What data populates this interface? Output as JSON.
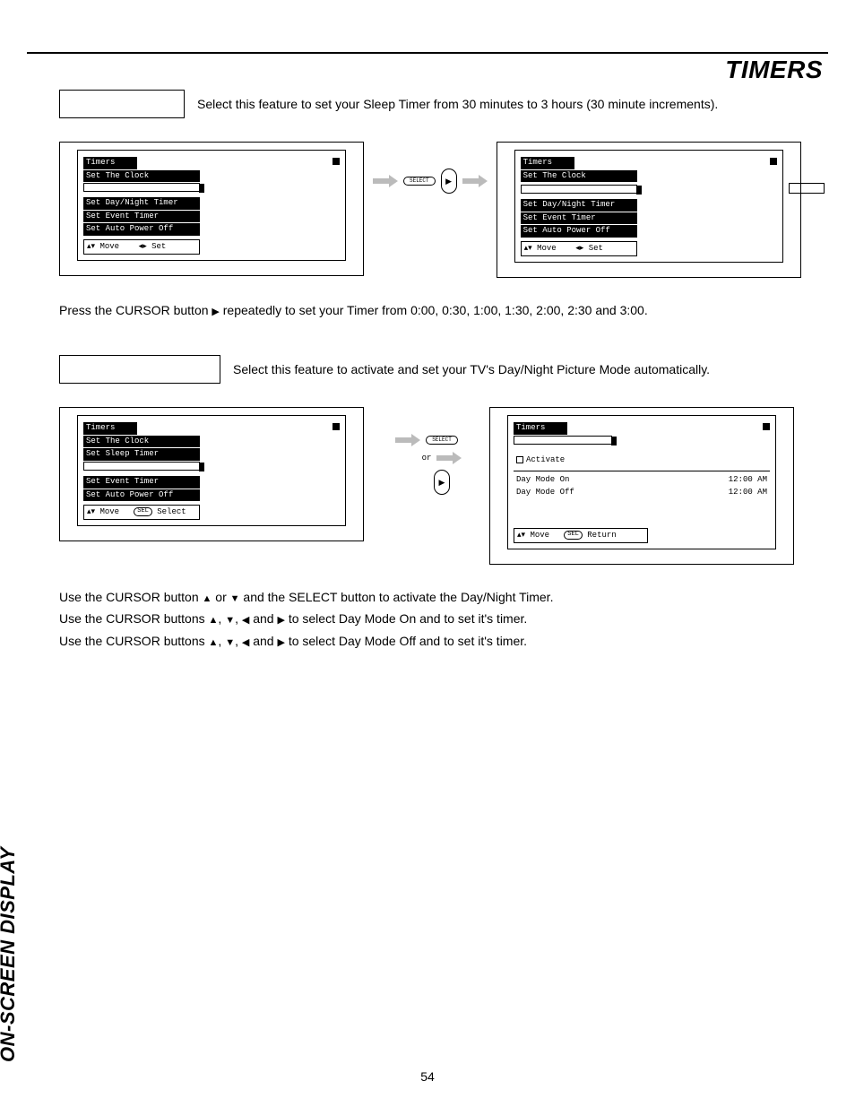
{
  "page_title": "TIMERS",
  "sidebar_label": "ON-SCREEN DISPLAY",
  "page_number": "54",
  "sleep": {
    "feature_label": "",
    "description": "Select this feature to set your Sleep Timer from 30 minutes to 3 hours (30 minute increments).",
    "instruction_prefix": "Press the CURSOR button ",
    "instruction_arrow": "▶",
    "instruction_suffix": " repeatedly to set your Timer from 0:00, 0:30, 1:00, 1:30, 2:00, 2:30 and 3:00.",
    "mid_button": "SELECT",
    "osd_left": {
      "title": "Timers",
      "items": [
        "Set The Clock"
      ],
      "selected_blank": true,
      "items_after": [
        "Set Day/Night Timer",
        "Set Event Timer",
        "Set Auto Power Off"
      ],
      "footer_move": "Move",
      "footer_set": "Set",
      "footer_set_glyph": "◂▸",
      "footer_move_glyph": "▴▾"
    },
    "osd_right": {
      "title": "Timers",
      "items": [
        "Set The Clock"
      ],
      "selected_blank": true,
      "items_after": [
        "Set Day/Night Timer",
        "Set Event Timer",
        "Set Auto Power Off"
      ],
      "footer_move": "Move",
      "footer_set": "Set",
      "footer_set_glyph": "◂▸",
      "footer_move_glyph": "▴▾",
      "value": ""
    }
  },
  "daynight": {
    "feature_label": "",
    "description": "Select this feature to activate and set your TV's Day/Night Picture Mode automatically.",
    "mid_button": "SELECT",
    "mid_or": "or",
    "mid_cursor_glyph": "▶",
    "osd_left": {
      "title": "Timers",
      "items": [
        "Set The Clock",
        "Set Sleep Timer"
      ],
      "selected_blank": true,
      "items_after": [
        "Set Event Timer",
        "Set Auto Power Off"
      ],
      "footer_move": "Move",
      "footer_select": "Select",
      "footer_move_glyph": "▴▾",
      "footer_sel_pill": "SEL"
    },
    "osd_right": {
      "title": "Timers",
      "activate": "Activate",
      "rows": [
        {
          "label": "Day Mode On",
          "time": "12:00 AM"
        },
        {
          "label": "Day Mode Off",
          "time": "12:00 AM"
        }
      ],
      "footer_move": "Move",
      "footer_return": "Return",
      "footer_move_glyph": "▴▾",
      "footer_sel_pill": "SEL"
    },
    "instructions": [
      {
        "pre": "Use the CURSOR button ",
        "g1": "▲",
        "mid1": " or ",
        "g2": "▼",
        "post": " and the SELECT button to activate the Day/Night Timer."
      },
      {
        "pre": "Use the CURSOR buttons ",
        "g1": "▲",
        "c1": ", ",
        "g2": "▼",
        "c2": ", ",
        "g3": "◀",
        "c3": " and ",
        "g4": "▶",
        "post": " to select Day Mode On and to set it's timer."
      },
      {
        "pre": "Use the CURSOR buttons ",
        "g1": "▲",
        "c1": ", ",
        "g2": "▼",
        "c2": ", ",
        "g3": "◀",
        "c3": " and ",
        "g4": "▶",
        "post": " to select Day Mode Off and to set it's timer."
      }
    ]
  }
}
